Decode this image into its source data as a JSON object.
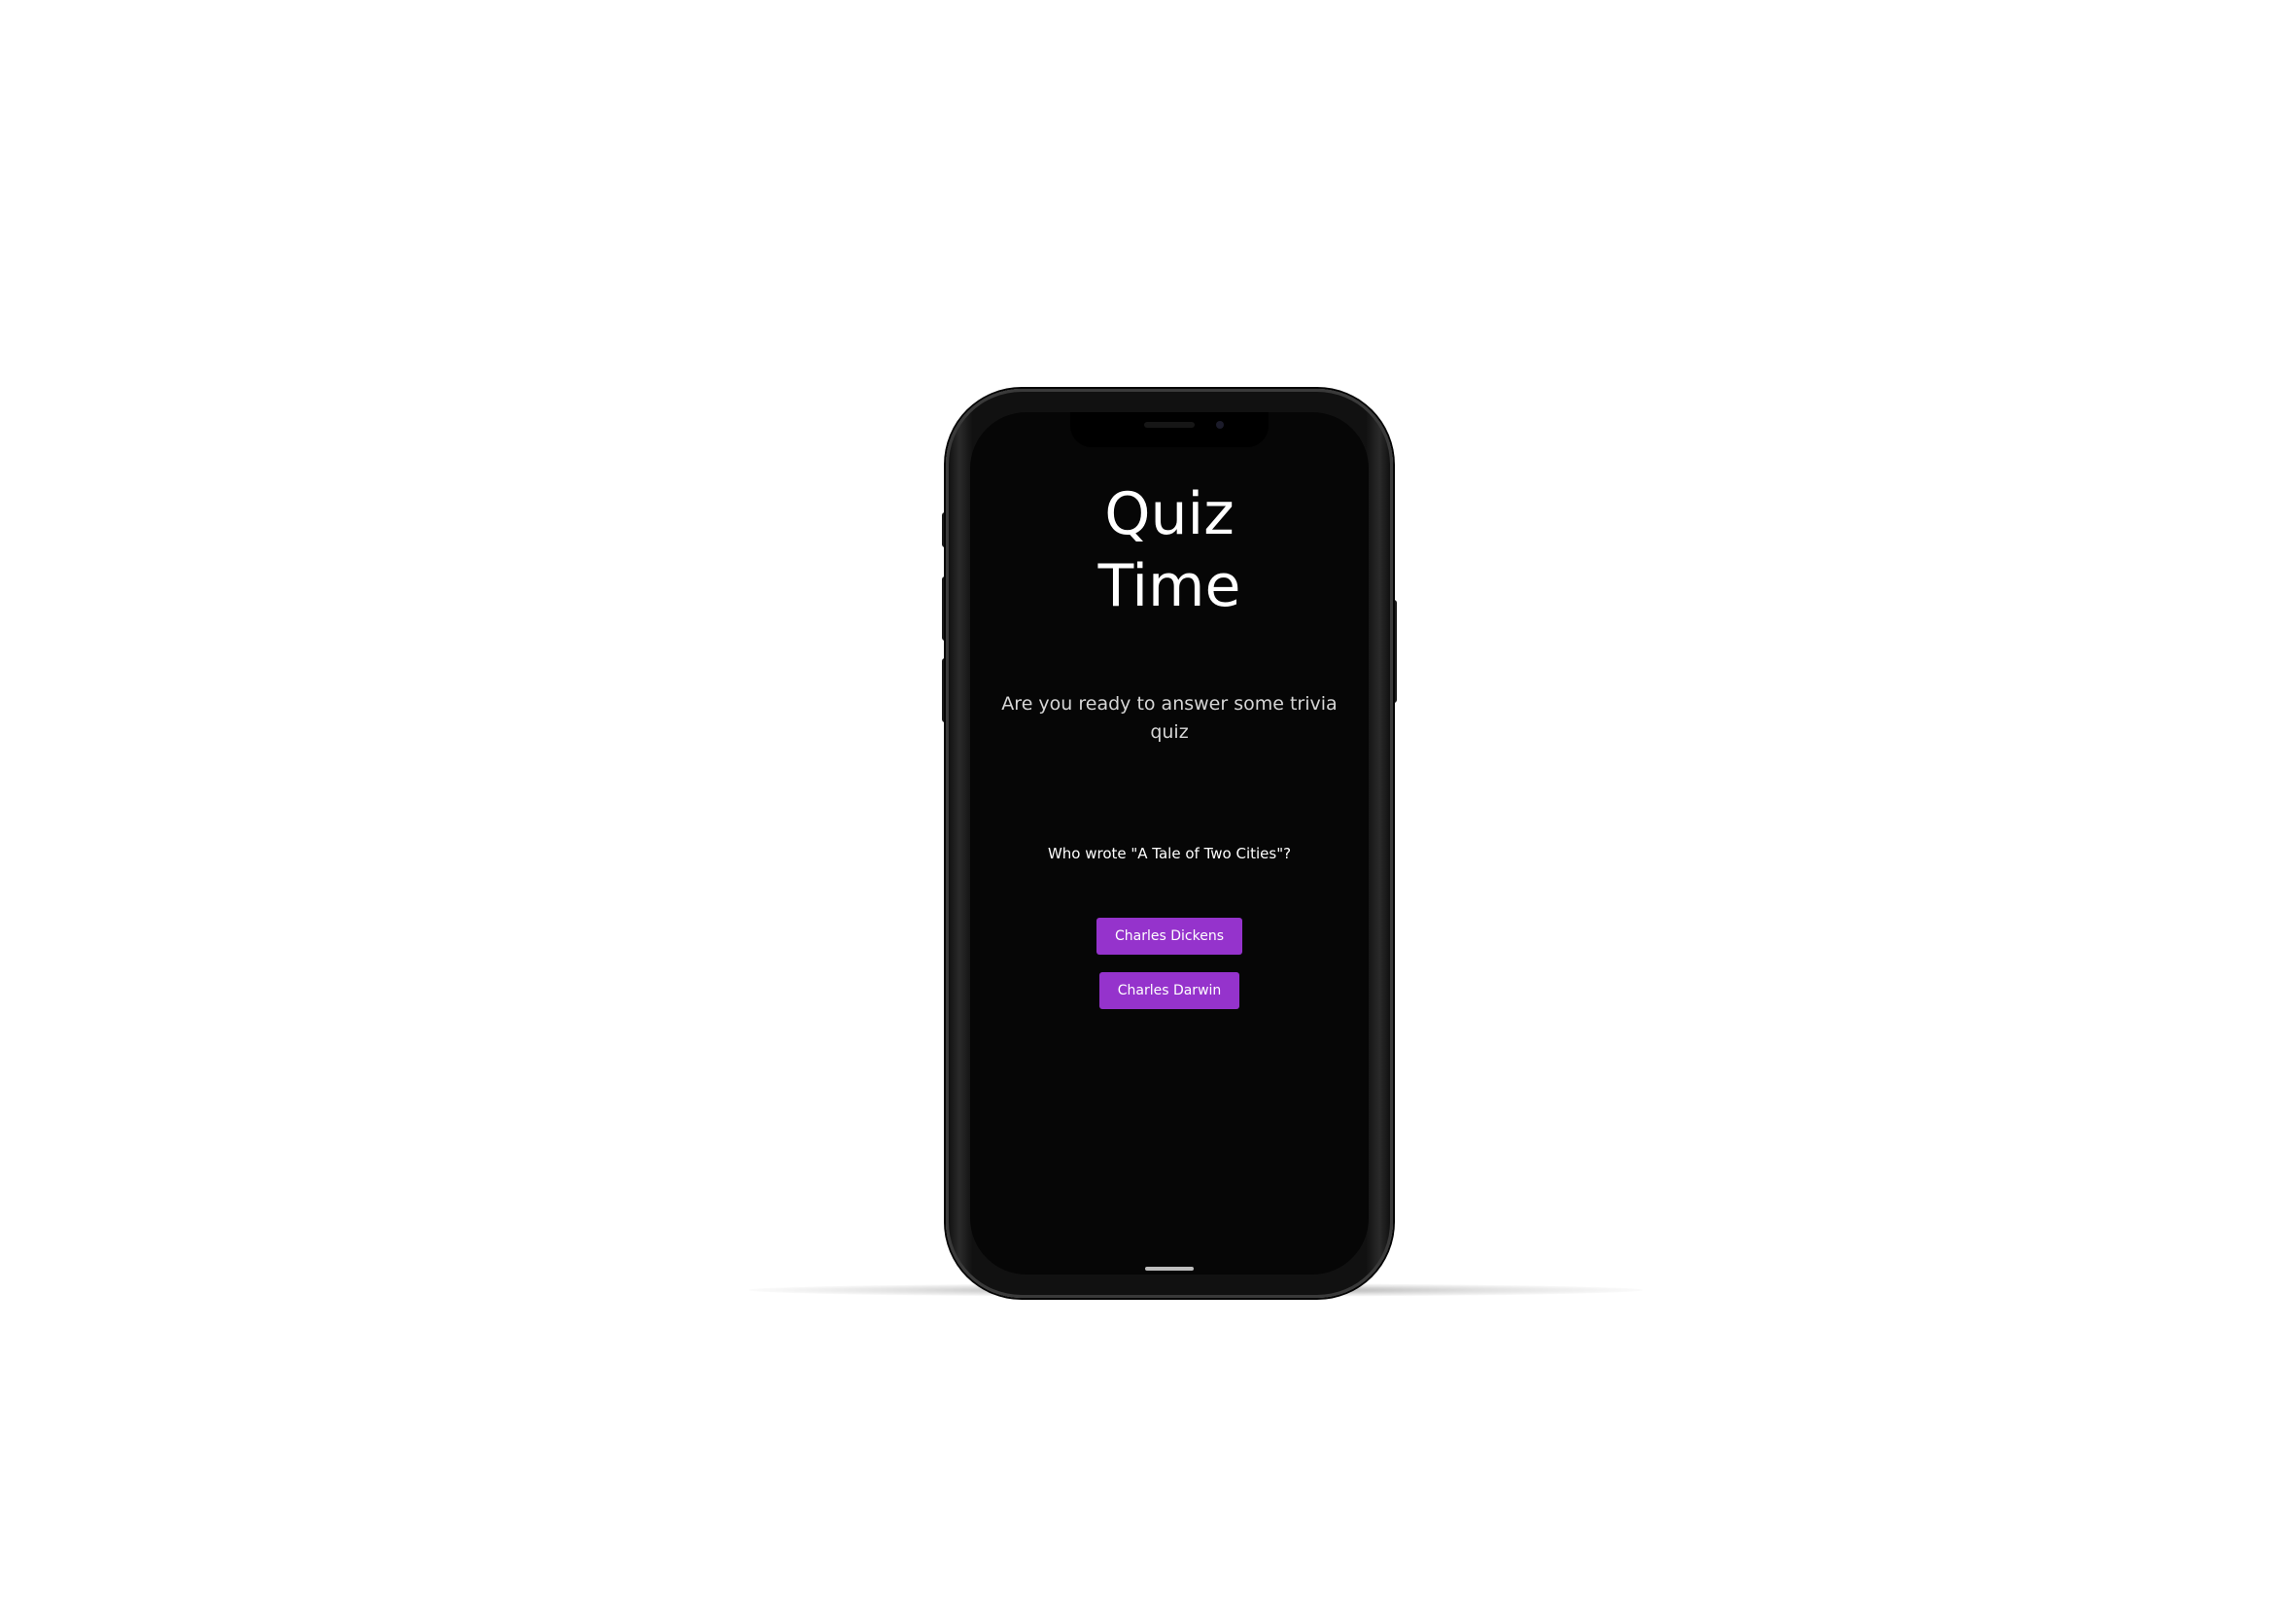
{
  "app": {
    "title_lines": [
      "Quiz",
      "Time"
    ],
    "subtitle": "Are you ready to answer some trivia quiz",
    "question": "Who wrote \"A Tale of Two Cities\"?",
    "answers": [
      {
        "label": "Charles Dickens"
      },
      {
        "label": "Charles Darwin"
      }
    ]
  },
  "colors": {
    "screen_background": "#060606",
    "answer_button": "#9533cc",
    "text": "#ffffff"
  },
  "device": {
    "icons": [
      "notch-speaker-icon",
      "front-camera-icon"
    ]
  }
}
